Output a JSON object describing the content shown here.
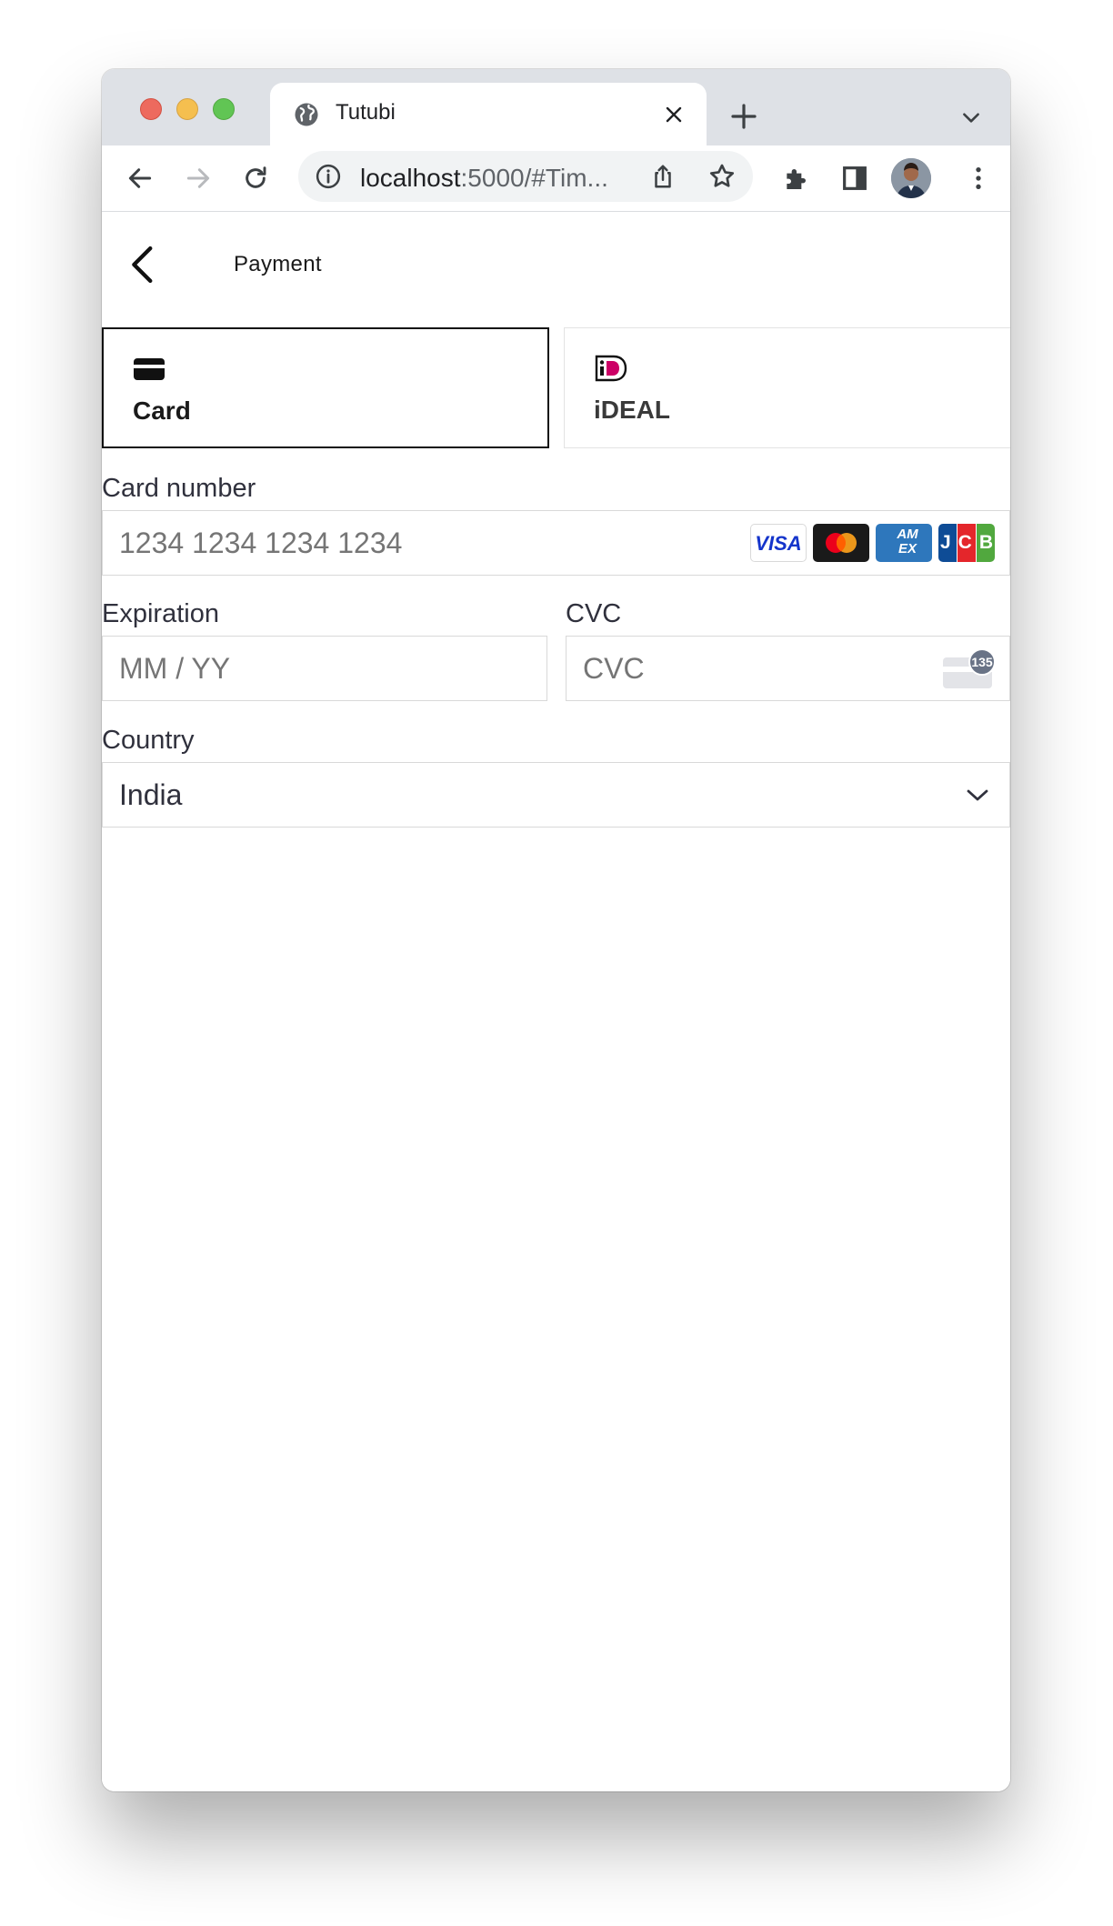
{
  "browser": {
    "tab_title": "Tutubi",
    "url_host": "localhost",
    "url_rest": ":5000/#Tim..."
  },
  "page": {
    "title": "Payment"
  },
  "payment_methods": [
    {
      "label": "Card",
      "selected": true
    },
    {
      "label": "iDEAL",
      "selected": false
    }
  ],
  "form": {
    "card_number": {
      "label": "Card number",
      "placeholder": "1234 1234 1234 1234"
    },
    "brands": [
      "VISA",
      "Mastercard",
      "AMEX",
      "JCB"
    ],
    "visa_text": "VISA",
    "amex_text": "AM EX",
    "jcb_text": "JCB",
    "expiration": {
      "label": "Expiration",
      "placeholder": "MM / YY"
    },
    "cvc": {
      "label": "CVC",
      "placeholder": "CVC",
      "badge": "135"
    },
    "country": {
      "label": "Country",
      "value": "India"
    }
  },
  "colors": {
    "ideal_brand": "#cc0066",
    "visa_blue": "#1434cb",
    "amex_blue": "#2e77bc"
  }
}
